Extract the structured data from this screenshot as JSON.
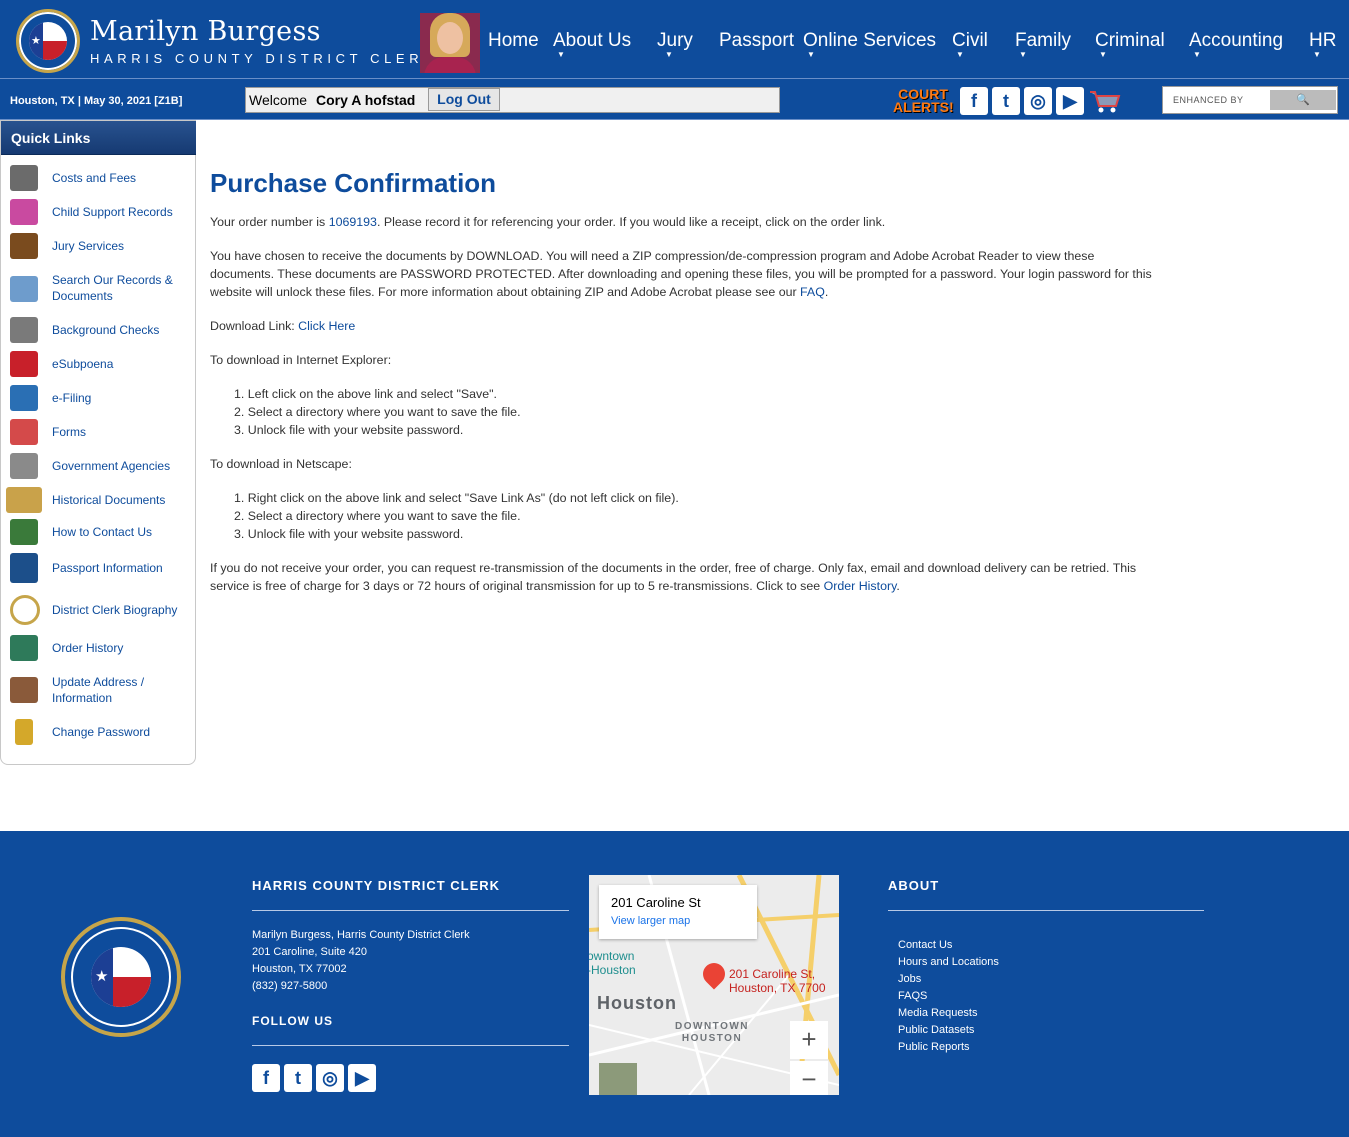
{
  "header": {
    "name": "Marilyn Burgess",
    "title": "HARRIS COUNTY DISTRICT CLERK",
    "nav": [
      {
        "label": "Home",
        "caret": false
      },
      {
        "label": "About Us",
        "caret": true
      },
      {
        "label": "Jury",
        "caret": true
      },
      {
        "label": "Passport",
        "caret": false
      },
      {
        "label": "Online Services",
        "caret": true
      },
      {
        "label": "Civil",
        "caret": true
      },
      {
        "label": "Family",
        "caret": true
      },
      {
        "label": "Criminal",
        "caret": true
      },
      {
        "label": "Accounting",
        "caret": true
      },
      {
        "label": "HR",
        "caret": true
      }
    ]
  },
  "subbar": {
    "date": "Houston, TX | May 30, 2021 [Z1B]",
    "welcome": "Welcome",
    "user": "Cory A hofstad",
    "logout": "Log Out",
    "court_alerts_1": "COURT",
    "court_alerts_2": "ALERTS!",
    "search_label": "ENHANCED BY",
    "social": [
      {
        "icon": "facebook-icon",
        "glyph": "f"
      },
      {
        "icon": "twitter-icon",
        "glyph": "t"
      },
      {
        "icon": "instagram-icon",
        "glyph": "◎"
      },
      {
        "icon": "youtube-icon",
        "glyph": "▶"
      }
    ]
  },
  "sidebar": {
    "title": "Quick Links",
    "items": [
      {
        "label": "Costs and Fees",
        "icon": "calculator-icon",
        "color": "#6b6b6b"
      },
      {
        "label": "Child Support Records",
        "icon": "abc-blocks-icon",
        "color": "#c94aa0"
      },
      {
        "label": "Jury Services",
        "icon": "gavel-icon",
        "color": "#7a4b1e"
      },
      {
        "label": "Search Our Records & Documents",
        "icon": "magnifier-icon",
        "color": "#6e9ccc"
      },
      {
        "label": "Background Checks",
        "icon": "fingerprint-icon",
        "color": "#7a7a7a"
      },
      {
        "label": "eSubpoena",
        "icon": "esubpoena-icon",
        "color": "#c8202a"
      },
      {
        "label": "e-Filing",
        "icon": "laptop-icon",
        "color": "#2a6fb4"
      },
      {
        "label": "Forms",
        "icon": "forms-icon",
        "color": "#d44a4a"
      },
      {
        "label": "Government Agencies",
        "icon": "building-icon",
        "color": "#8a8a8a"
      },
      {
        "label": "Historical Documents",
        "icon": "book-icon",
        "color": "#c9a24a"
      },
      {
        "label": "How to Contact Us",
        "icon": "contact-icon",
        "color": "#3a7a3a"
      },
      {
        "label": "Passport Information",
        "icon": "passport-icon",
        "color": "#1c4f8a"
      },
      {
        "label": "District Clerk Biography",
        "icon": "seal-icon",
        "color": "#0e4c9c"
      },
      {
        "label": "Order History",
        "icon": "ledger-icon",
        "color": "#2e7a5a"
      },
      {
        "label": "Update Address / Information",
        "icon": "person-icon",
        "color": "#8a5a3a"
      },
      {
        "label": "Change Password",
        "icon": "key-icon",
        "color": "#d4a82a"
      }
    ]
  },
  "main": {
    "title": "Purchase Confirmation",
    "order_pre": "Your order number is ",
    "order_number": "1069193",
    "order_post": ". Please record it for referencing your order. If you would like a receipt, click on the order link.",
    "download_para_1": "You have chosen to receive the documents by DOWNLOAD. You will need a ZIP compression/de-compression program and Adobe Acrobat Reader to view these",
    "download_para_2": "documents. These documents are PASSWORD PROTECTED. After downloading and opening these files, you will be prompted for a password. Your login password for this",
    "download_para_3": "website will unlock these files. For more information about obtaining ZIP and Adobe Acrobat please see our ",
    "faq_link": "FAQ",
    "period": ".",
    "download_link_label": "Download Link: ",
    "download_link": "Click Here",
    "ie_heading": "To download in Internet Explorer:",
    "ie_steps": [
      "Left click on the above link and select \"Save\".",
      "Select a directory where you want to save the file.",
      "Unlock file with your website password."
    ],
    "ns_heading": "To download in Netscape:",
    "ns_steps": [
      "Right click on the above link and select \"Save Link As\" (do not left click on file).",
      "Select a directory where you want to save the file.",
      "Unlock file with your website password."
    ],
    "retrans_1": "If you do not receive your order, you can request re-transmission of the documents in the order, free of charge. Only fax, email and download delivery can be retried. This",
    "retrans_2": "service is free of charge for 3 days or 72 hours of original transmission for up to 5 re-transmissions. Click to see ",
    "order_history_link": "Order History",
    "period2": "."
  },
  "footer": {
    "clerk_heading": "HARRIS COUNTY DISTRICT CLERK",
    "address": [
      "Marilyn Burgess, Harris County District Clerk",
      "201 Caroline, Suite 420",
      "Houston, TX 77002",
      "(832) 927-5800"
    ],
    "follow_heading": "FOLLOW US",
    "about_heading": "ABOUT",
    "about_links": [
      "Contact Us",
      "Hours and Locations",
      "Jobs",
      "FAQS",
      "Media Requests",
      "Public Datasets",
      "Public Reports"
    ],
    "map": {
      "title": "201 Caroline St",
      "link": "View larger map",
      "pin_address": "201 Caroline St, Houston, TX 7700",
      "city": "Houston",
      "downtown_1": "DOWNTOWN",
      "downtown_2": "HOUSTON",
      "poi_1": "owntown",
      "poi_2": "-Houston",
      "zoom_in": "+",
      "zoom_out": "−"
    }
  },
  "colors": {
    "brand_blue": "#0e4c9c",
    "link_blue": "#0e4c9c",
    "text_gray": "#333333",
    "alert_orange": "#ff7a12"
  }
}
